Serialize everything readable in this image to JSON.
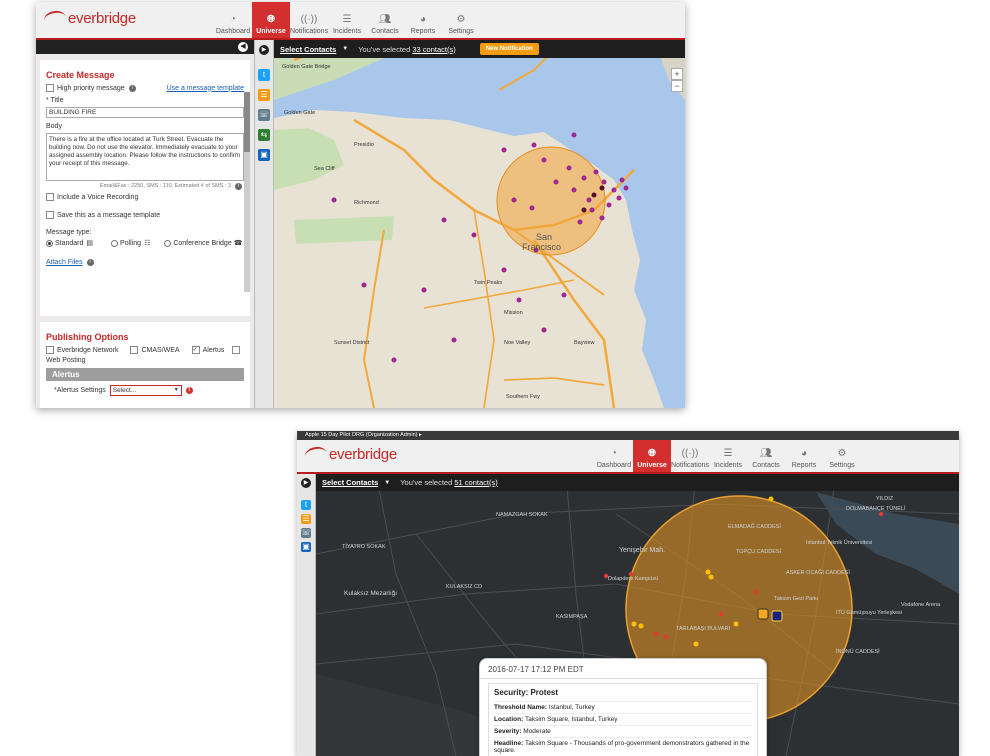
{
  "app": {
    "logo_text": "everbridge",
    "nav": [
      {
        "label": "Dashboard",
        "icon": "dashboard-icon",
        "active": false
      },
      {
        "label": "Universe",
        "icon": "globe-icon",
        "active": true
      },
      {
        "label": "Notifications",
        "icon": "broadcast-icon",
        "active": false
      },
      {
        "label": "Incidents",
        "icon": "list-icon",
        "active": false
      },
      {
        "label": "Contacts",
        "icon": "people-icon",
        "active": false
      },
      {
        "label": "Reports",
        "icon": "pie-chart-icon",
        "active": false
      },
      {
        "label": "Settings",
        "icon": "gear-icon",
        "active": false
      }
    ],
    "accent": "#d32f2f"
  },
  "win1": {
    "create_message": {
      "title": "Create Message",
      "high_priority_label": "High priority message",
      "use_template_link": "Use a message template",
      "title_field_label": "* Title",
      "title_value": "BUILDING FIRE",
      "body_label": "Body",
      "body_value": "There is a fire at the office located at Turk Street.  Evacuate the building now. Do not use the elevator.  Immediately evacuate to your assigned assembly location.  Please follow the instructions to confirm your receipt of this message.",
      "counts": "Email&Fax : 2250, SMS : 110, Estimated # of SMS : 3",
      "voice_recording": "Include a Voice Recording",
      "save_template": "Save this as a message template",
      "message_type_label": "Message type:",
      "type_standard": "Standard",
      "type_polling": "Polling",
      "type_conference": "Conference Bridge",
      "attach_files": "Attach Files"
    },
    "publishing": {
      "title": "Publishing Options",
      "everbridge_network": "Everbridge Network",
      "cmas": "CMAS/WEA",
      "alertus": "Alertus",
      "web_posting": "Web Posting",
      "alertus_header": "Alertus",
      "alertus_settings_label": "*Alertus Settings",
      "alertus_select": "Select..."
    },
    "map": {
      "select_contacts": "Select Contacts",
      "selected_prefix": "You've selected",
      "selected_count": "33 contact(s)",
      "new_notification": "New Notification",
      "labels": {
        "golden_gate": "Golden Gate",
        "golden_gate_bridge": "Golden Gate Bridge",
        "sea_cliff": "Sea Cliff",
        "presidio": "Presidio",
        "sf_line1": "San",
        "sf_line2": "Francisco",
        "bayview": "Bayview",
        "mission": "Mission",
        "sunset": "Sunset District",
        "noe_valley": "Noe Valley",
        "twin_peaks": "Twin Peaks",
        "richmond": "Richmond",
        "southern_fwy": "Southern Fwy"
      }
    }
  },
  "win2": {
    "breadcrumb": "Apple 15 Day Pilot ORG (Organization Admin)",
    "map": {
      "select_contacts": "Select Contacts",
      "selected_prefix": "You've selected",
      "selected_count": "51 contact(s)",
      "labels": {
        "yenisehir": "Yenişehir Mah.",
        "dolapdere": "Dolapdere Kampüsü",
        "kulaksiz": "Kulaksız Mezarlığı",
        "elmadag": "ELMADAĞ CADDESİ",
        "itu": "İstanbul Teknik Üniversitesi",
        "asker": "ASKER OCAĞI CADDESİ",
        "taksim_gezi": "Taksim Gezi Parkı",
        "itu_gumussuyu": "İTÜ Gümüşsuyu Yerleşkesi",
        "vodafone": "Vodafone Arena",
        "tarlabasi": "TARLABAŞI BULVARI",
        "inonu": "İNÖNÜ CADDESİ",
        "namazgah": "NAMAZGAH SOKAK",
        "tiyatro": "TİYATRO SOKAK",
        "kulaksiz_cd": "KULAKSIZ CD",
        "kasimpasa": "KASIMPAŞA",
        "topcu": "TOPÇU CADDESİ",
        "yildiz": "YILDIZ",
        "dolmabahce": "DOLMABAHÇE TÜNELİ"
      }
    },
    "popup": {
      "datetime": "2016-07-17  17:12 PM EDT",
      "title": "Security: Protest",
      "threshold_key": "Threshold Name:",
      "threshold_val": "Istanbul, Turkey",
      "location_key": "Location:",
      "location_val": "Taksim Square, Istanbul, Turkey",
      "severity_key": "Severity:",
      "severity_val": "Moderate",
      "headline_key": "Headline:",
      "headline_val": "Taksim Square - Thousands of pro-government demonstrators gathered in the square."
    }
  }
}
